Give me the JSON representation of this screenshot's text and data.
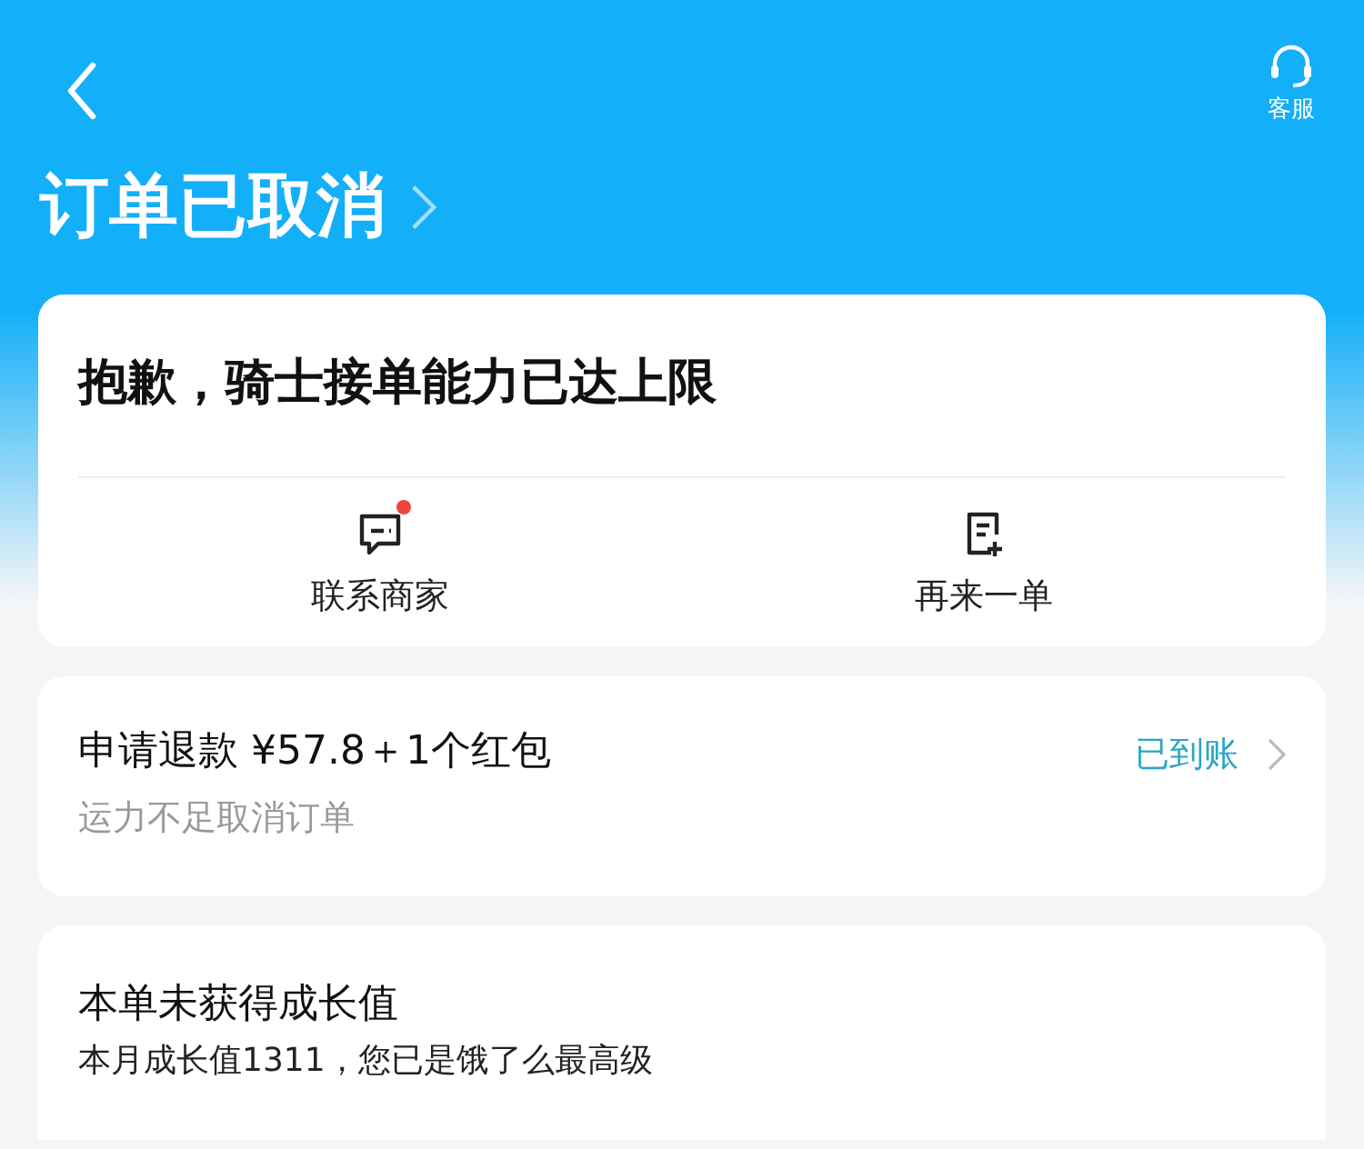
{
  "header": {
    "support_label": "客服",
    "title": "订单已取消"
  },
  "status_card": {
    "message": "抱歉，骑士接单能力已达上限",
    "actions": [
      {
        "kind": "chat",
        "label": "联系商家",
        "unread": true
      },
      {
        "kind": "reorder",
        "label": "再来一单",
        "unread": false
      }
    ]
  },
  "refund": {
    "title": "申请退款 ¥57.8＋1个红包",
    "reason": "运力不足取消订单",
    "status": "已到账"
  },
  "growth": {
    "title": "本单未获得成长值",
    "detail": "本月成长值1311，您已是饿了么最高级"
  }
}
